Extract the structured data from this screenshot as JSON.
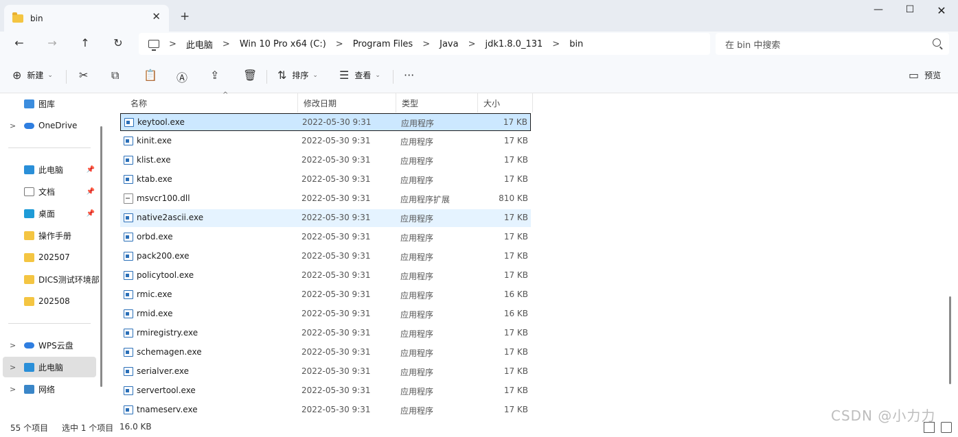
{
  "window": {
    "tab_title": "bin",
    "close_glyph": "✕",
    "newtab_glyph": "+",
    "min_glyph": "—",
    "max_glyph": "☐",
    "winclose_glyph": "✕"
  },
  "nav": {
    "back": "←",
    "forward": "→",
    "up": "↑",
    "refresh": "↻",
    "breadcrumb": [
      "此电脑",
      "Win 10 Pro x64 (C:)",
      "Program Files",
      "Java",
      "jdk1.8.0_131",
      "bin"
    ],
    "sep": ">",
    "search_placeholder": "在 bin 中搜索"
  },
  "toolbar": {
    "new_label": "新建",
    "sort_label": "排序",
    "view_label": "查看",
    "more_label": "···",
    "preview_label": "预览",
    "icons": {
      "new": "⊕",
      "cut": "✂",
      "copy": "⧉",
      "paste": "📋",
      "rename": "Ⓐ",
      "share": "⇪",
      "delete": "🗑",
      "sort": "⇅",
      "view": "☰",
      "preview": "▭",
      "caret": "⌄"
    }
  },
  "sidebar": {
    "items": [
      {
        "label": "图库",
        "icon": "gallery-icon",
        "chevron": ""
      },
      {
        "label": "OneDrive",
        "icon": "cloud-icon",
        "chevron": ">"
      },
      {
        "label": "此电脑",
        "icon": "pc-icon",
        "pin": "📌"
      },
      {
        "label": "文档",
        "icon": "document-icon",
        "pin": "📌"
      },
      {
        "label": "桌面",
        "icon": "desktop-icon",
        "pin": "📌"
      },
      {
        "label": "操作手册",
        "icon": "folder-icon"
      },
      {
        "label": "202507",
        "icon": "folder-icon"
      },
      {
        "label": "DICS测试环境部",
        "icon": "folder-icon"
      },
      {
        "label": "202508",
        "icon": "folder-icon"
      },
      {
        "label": "WPS云盘",
        "icon": "cloud-icon",
        "chevron": ">"
      },
      {
        "label": "此电脑",
        "icon": "pc-icon",
        "chevron": ">"
      },
      {
        "label": "网络",
        "icon": "network-icon",
        "chevron": ">"
      }
    ]
  },
  "columns": {
    "name": "名称",
    "date": "修改日期",
    "type": "类型",
    "size": "大小",
    "sort_glyph": "^"
  },
  "files": [
    {
      "name": "keytool.exe",
      "date": "2022-05-30 9:31",
      "type": "应用程序",
      "size": "17 KB"
    },
    {
      "name": "kinit.exe",
      "date": "2022-05-30 9:31",
      "type": "应用程序",
      "size": "17 KB"
    },
    {
      "name": "klist.exe",
      "date": "2022-05-30 9:31",
      "type": "应用程序",
      "size": "17 KB"
    },
    {
      "name": "ktab.exe",
      "date": "2022-05-30 9:31",
      "type": "应用程序",
      "size": "17 KB"
    },
    {
      "name": "msvcr100.dll",
      "date": "2022-05-30 9:31",
      "type": "应用程序扩展",
      "size": "810 KB"
    },
    {
      "name": "native2ascii.exe",
      "date": "2022-05-30 9:31",
      "type": "应用程序",
      "size": "17 KB"
    },
    {
      "name": "orbd.exe",
      "date": "2022-05-30 9:31",
      "type": "应用程序",
      "size": "17 KB"
    },
    {
      "name": "pack200.exe",
      "date": "2022-05-30 9:31",
      "type": "应用程序",
      "size": "17 KB"
    },
    {
      "name": "policytool.exe",
      "date": "2022-05-30 9:31",
      "type": "应用程序",
      "size": "17 KB"
    },
    {
      "name": "rmic.exe",
      "date": "2022-05-30 9:31",
      "type": "应用程序",
      "size": "16 KB"
    },
    {
      "name": "rmid.exe",
      "date": "2022-05-30 9:31",
      "type": "应用程序",
      "size": "16 KB"
    },
    {
      "name": "rmiregistry.exe",
      "date": "2022-05-30 9:31",
      "type": "应用程序",
      "size": "17 KB"
    },
    {
      "name": "schemagen.exe",
      "date": "2022-05-30 9:31",
      "type": "应用程序",
      "size": "17 KB"
    },
    {
      "name": "serialver.exe",
      "date": "2022-05-30 9:31",
      "type": "应用程序",
      "size": "17 KB"
    },
    {
      "name": "servertool.exe",
      "date": "2022-05-30 9:31",
      "type": "应用程序",
      "size": "17 KB"
    },
    {
      "name": "tnameserv.exe",
      "date": "2022-05-30 9:31",
      "type": "应用程序",
      "size": "17 KB"
    }
  ],
  "status": {
    "count": "55 个项目",
    "selected": "选中 1 个项目",
    "size": "16.0 KB"
  },
  "watermark": "CSDN @小力力",
  "colors": {
    "selected_bg": "#cce8ff",
    "hover_bg": "#e5f3ff",
    "folder": "#f4c542",
    "chrome_bg": "#f7f9fc"
  }
}
